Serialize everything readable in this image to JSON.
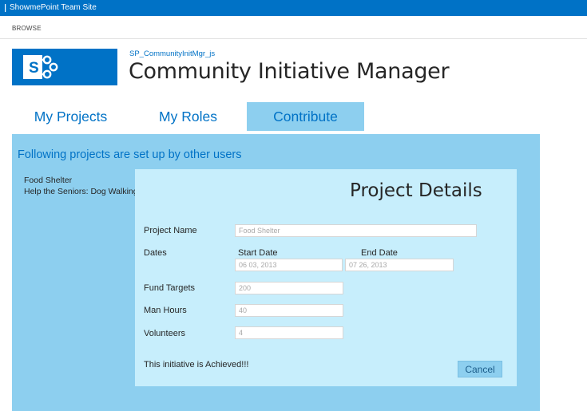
{
  "suite_bar": {
    "site_title": "ShowmePoint Team Site"
  },
  "ribbon": {
    "browse_label": "BROWSE"
  },
  "header": {
    "app_link": "SP_CommunityInitMgr_js",
    "title": "Community Initiative Manager"
  },
  "tabs": [
    {
      "label": "My Projects",
      "selected": false
    },
    {
      "label": "My Roles",
      "selected": false
    },
    {
      "label": "Contribute",
      "selected": true
    }
  ],
  "panel": {
    "heading": "Following projects are set up by other users",
    "projects": [
      "Food Shelter",
      "Help the Seniors: Dog Walking"
    ]
  },
  "details": {
    "title": "Project Details",
    "project_name_label": "Project Name",
    "project_name_value": "Food Shelter",
    "dates_label": "Dates",
    "start_date_label": "Start Date",
    "end_date_label": "End Date",
    "start_date_value": "06 03, 2013",
    "end_date_value": "07 26, 2013",
    "fund_targets_label": "Fund Targets",
    "fund_targets_value": "200",
    "man_hours_label": "Man Hours",
    "man_hours_value": "40",
    "volunteers_label": "Volunteers",
    "volunteers_value": "4",
    "status_text": "This initiative is Achieved!!!",
    "cancel_label": "Cancel"
  },
  "colors": {
    "suite_bar": "#0072c6",
    "accent": "#0072c6",
    "panel_bg": "#8dcfef",
    "details_bg": "#c7eefc"
  },
  "icons": [
    "sharepoint-logo-icon",
    "back-arrow-icon"
  ]
}
